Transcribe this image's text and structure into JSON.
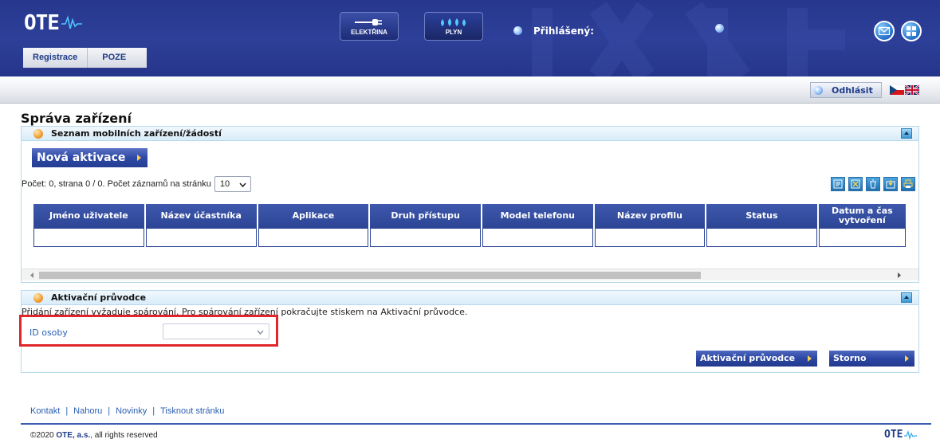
{
  "header": {
    "logo_text": "OTE",
    "tabs": [
      {
        "label": "Registrace"
      },
      {
        "label": "POZE"
      }
    ],
    "commodities": {
      "electricity": "ELEKTŘINA",
      "gas": "PLYN"
    },
    "user_label": "Přihlášený:"
  },
  "subbar": {
    "logout_label": "Odhlásit"
  },
  "page": {
    "title": "Správa zařízení"
  },
  "devices_panel": {
    "title": "Seznam mobilních zařízení/žádostí",
    "new_button": "Nová aktivace",
    "count_text": "Počet: 0, strana 0 / 0. Počet záznamů na stránku",
    "page_size": "10",
    "columns": [
      "Jméno uživatele",
      "Název účastníka",
      "Aplikace",
      "Druh přístupu",
      "Model telefonu",
      "Název profilu",
      "Status",
      "Datum a čas vytvoření"
    ],
    "tool_icons": [
      "new-record-icon",
      "export-excel-icon",
      "delete-icon",
      "import-icon",
      "print-icon"
    ]
  },
  "wizard_panel": {
    "title": "Aktivační průvodce",
    "info": "Přidání zařízení vyžaduje spárování. Pro spárování zařízení pokračujte stiskem na Aktivační průvodce.",
    "id_label": "ID osoby",
    "id_value": "",
    "wizard_button": "Aktivační průvodce",
    "cancel_button": "Storno"
  },
  "footer": {
    "links": [
      "Kontakt",
      "Nahoru",
      "Novinky",
      "Tisknout stránku"
    ],
    "copyright_prefix": "©2020",
    "company": "OTE, a.s.",
    "copyright_suffix": ", all rights reserved",
    "logo_text": "OTE"
  },
  "colors": {
    "header_blue": "#2d3f98",
    "accent_red": "#e0262a",
    "panel_border": "#b9d9ee",
    "button_blue": "#2c47a3"
  }
}
